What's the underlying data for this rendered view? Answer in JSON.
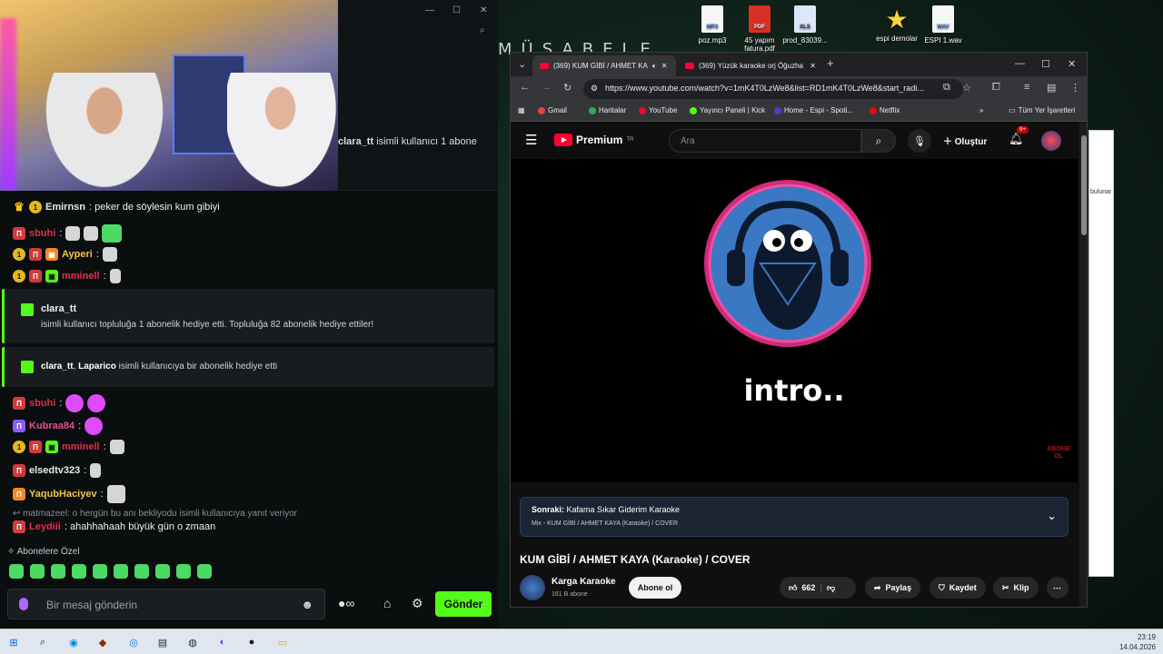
{
  "desktop": {
    "icons": [
      {
        "label": "poz.mp3",
        "kind": "MP3"
      },
      {
        "label": "45 yapım fatura.pdf",
        "kind": "PDF"
      },
      {
        "label": "prod_83039...",
        "kind": "XLS"
      },
      {
        "label": "espi demolar",
        "kind": "star"
      },
      {
        "label": "ESPI 1.wav",
        "kind": "WAV"
      }
    ],
    "banner": "MÜSABELE",
    "side_hint": "bulunar"
  },
  "popup": {
    "notice_user": "clara_tt",
    "notice_text": " isimli kullanıcı 1 abone"
  },
  "chat": {
    "messages": [
      {
        "user": "Emirnsn",
        "text": ": peker de söylesin kum gibiyi",
        "color": "#e8e8e8"
      },
      {
        "user": "sbuhi",
        "text": ":",
        "color": "#e02d4a"
      },
      {
        "user": "Ayperi",
        "text": ":",
        "color": "#f3c24b"
      },
      {
        "user": "mminell",
        "text": ":",
        "color": "#e02d4a"
      },
      {
        "user": "sbuhi",
        "text": ":",
        "color": "#e02d4a"
      },
      {
        "user": "Kubraa84",
        "text": ":",
        "color": "#e74c8c"
      },
      {
        "user": "mminell",
        "text": ":",
        "color": "#e02d4a"
      },
      {
        "user": "elsedtv323",
        "text": ":",
        "color": "#e8e8e8"
      },
      {
        "user": "YaqubHaciyev",
        "text": ":",
        "color": "#f3c24b"
      },
      {
        "user": "Leydiii",
        "text": ": ahahhahaah büyük gün o zmaan",
        "color": "#e02d4a"
      }
    ],
    "gift1": {
      "user": "clara_tt",
      "text": "isimli kullanıcı topluluğa 1 abonelik hediye etti. Topluluğa 82 abonelik hediye ettiler!"
    },
    "gift2": {
      "user1": "clara_tt",
      "sep": ", ",
      "user2": "Laparico",
      "text": " isimli kullanıcıya bir abonelik hediye etti"
    },
    "reply_line": "matmazeel: o hergün bu anı bekliyodu isimli kullanıcıya yanıt veriyor",
    "sub_only_label": "Abonelere Özel",
    "composer_placeholder": "Bir mesaj gönderin",
    "send_label": "Gönder"
  },
  "browser": {
    "tabs": [
      {
        "title": "(369) KUM GİBİ / AHMET KA",
        "active": true
      },
      {
        "title": "(369) Yüzük karaoke orj Öğuzha",
        "active": false
      }
    ],
    "url": "https://www.youtube.com/watch?v=1mK4T0LzWe8&list=RD1mK4T0LzWe8&start_radi...",
    "bookmarks": [
      {
        "label": "Gmail",
        "color": "#ea4335"
      },
      {
        "label": "Haritalar",
        "color": "#34a853"
      },
      {
        "label": "YouTube",
        "color": "#ff0033"
      },
      {
        "label": "Yayıncı Paneli | Kick",
        "color": "#53fc18"
      },
      {
        "label": "Home - Espi - Spoti...",
        "color": "#4b3cc8"
      },
      {
        "label": "Netflix",
        "color": "#e50914"
      }
    ],
    "bookmarks_all": "Tüm Yer İşaretleri"
  },
  "youtube": {
    "logo": "Premium",
    "region": "TR",
    "search_placeholder": "Ara",
    "create_label": "Oluştur",
    "notifications": "9+",
    "overlay_text": "intro..",
    "stamp_text": "ABONE OL",
    "next_label": "Sonraki:",
    "next_title": " Kafama Sıkar Giderim Karaoke",
    "mix_line": "Mix - KUM GİBİ / AHMET KAYA (Karaoke) / COVER",
    "video_title": "KUM GİBİ / AHMET KAYA (Karaoke) / COVER",
    "channel": "Karga Karaoke",
    "subscribers": "161 B abone",
    "subscribe_label": "Abone ol",
    "likes": "662",
    "share_label": "Paylaş",
    "save_label": "Kaydet",
    "clip_label": "Klip"
  },
  "taskbar": {
    "time": "23:19",
    "date": "14.04.2026"
  },
  "colors": {
    "kick_green": "#53fc18",
    "yt_red": "#ff0033"
  }
}
